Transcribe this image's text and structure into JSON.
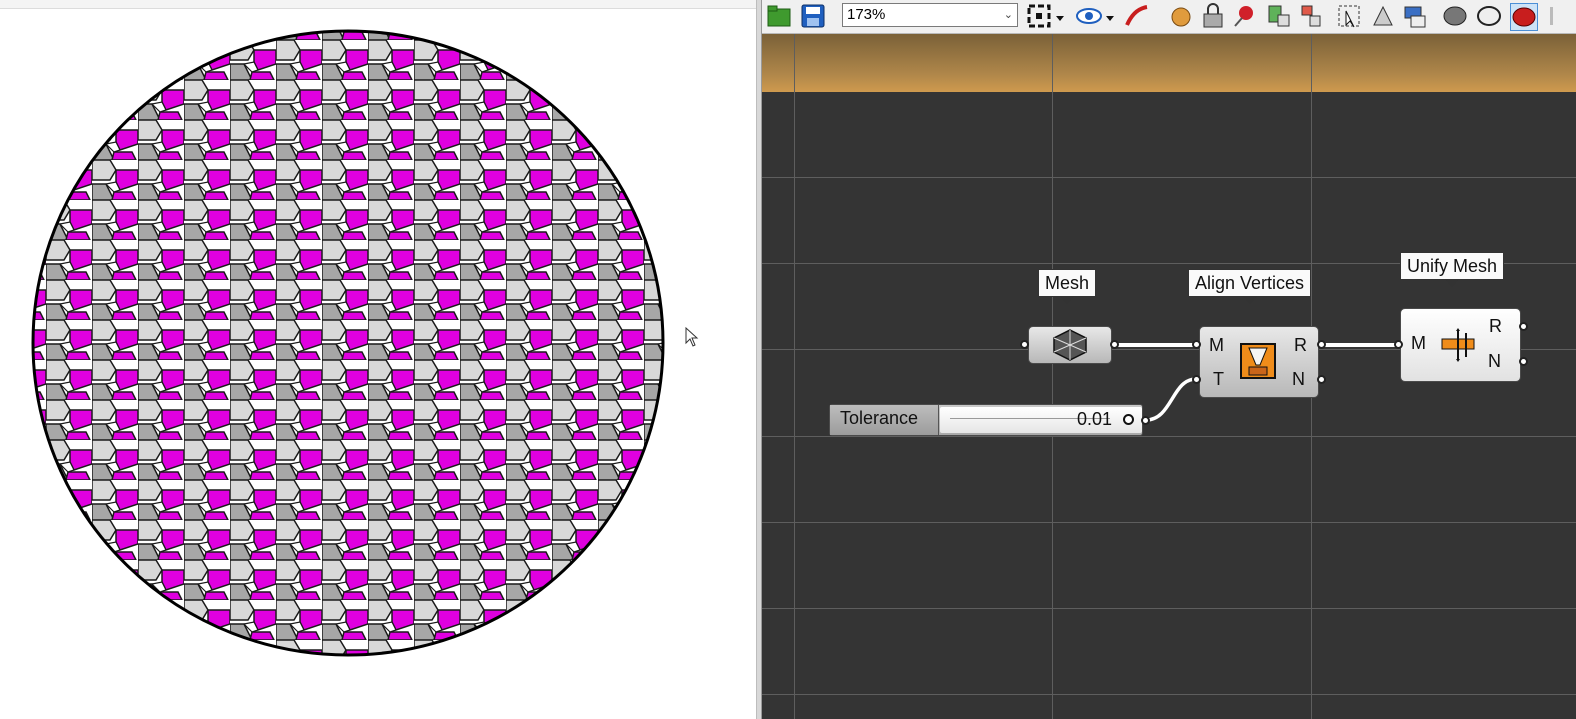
{
  "toolbar": {
    "zoom_level": "173%",
    "icons": [
      "open-file-icon",
      "save-icon",
      "zoom-extents-icon",
      "preview-eye-icon",
      "sketch-icon",
      "bake-icon",
      "lock-icon",
      "pin-icon",
      "group-icon",
      "cluster-icon",
      "select-icon",
      "geometry-icon",
      "export-icon",
      "mesh-shade-icon",
      "wire-icon",
      "render-icon"
    ]
  },
  "nodes": {
    "mesh": {
      "label": "Mesh"
    },
    "align": {
      "label": "Align Vertices",
      "in_m": "M",
      "in_t": "T",
      "out_r": "R",
      "out_n": "N"
    },
    "unify": {
      "label": "Unify Mesh",
      "in_m": "M",
      "out_r": "R",
      "out_n": "N"
    },
    "tolerance": {
      "label": "Tolerance",
      "value": "0.01"
    }
  },
  "colors": {
    "canvas": "#343434",
    "accent_face": "#e000e0",
    "grid": "#5e5e5e"
  }
}
